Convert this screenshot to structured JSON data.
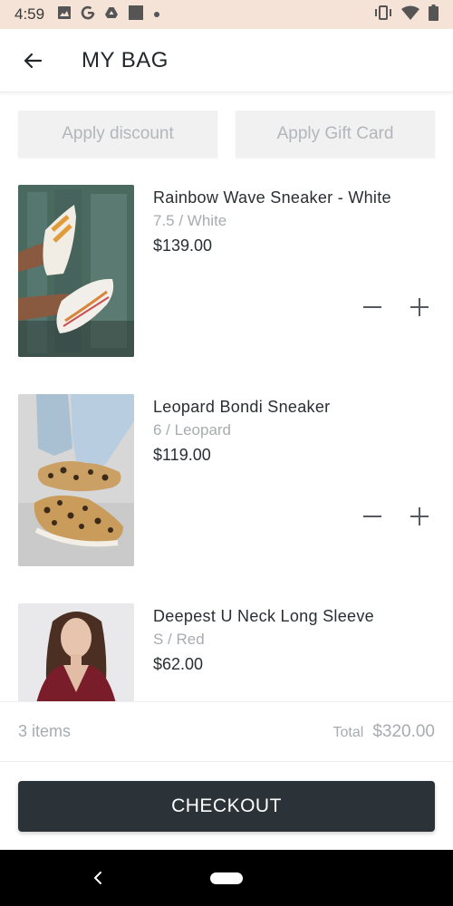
{
  "status_bar": {
    "time": "4:59",
    "left_icons": [
      "image-icon",
      "google-icon",
      "drive-icon",
      "app-square-icon",
      "dot-icon"
    ],
    "right_icons": [
      "vibrate-icon",
      "wifi-icon",
      "battery-icon"
    ]
  },
  "header": {
    "title": "MY BAG"
  },
  "actions": {
    "discount_label": "Apply discount",
    "gift_card_label": "Apply Gift Card"
  },
  "items": [
    {
      "name": "Rainbow Wave Sneaker - White",
      "variant": "7.5 / White",
      "price": "$139.00"
    },
    {
      "name": "Leopard Bondi Sneaker",
      "variant": "6 / Leopard",
      "price": "$119.00"
    },
    {
      "name": "Deepest U Neck Long Sleeve",
      "variant": "S / Red",
      "price": "$62.00"
    }
  ],
  "summary": {
    "count": "3 items",
    "total_label": "Total",
    "total_value": "$320.00"
  },
  "checkout": {
    "label": "CHECKOUT"
  },
  "colors": {
    "status_bar_bg": "#f4e3d6",
    "checkout_bg": "#2b3238",
    "muted_text": "#a8abaf"
  }
}
